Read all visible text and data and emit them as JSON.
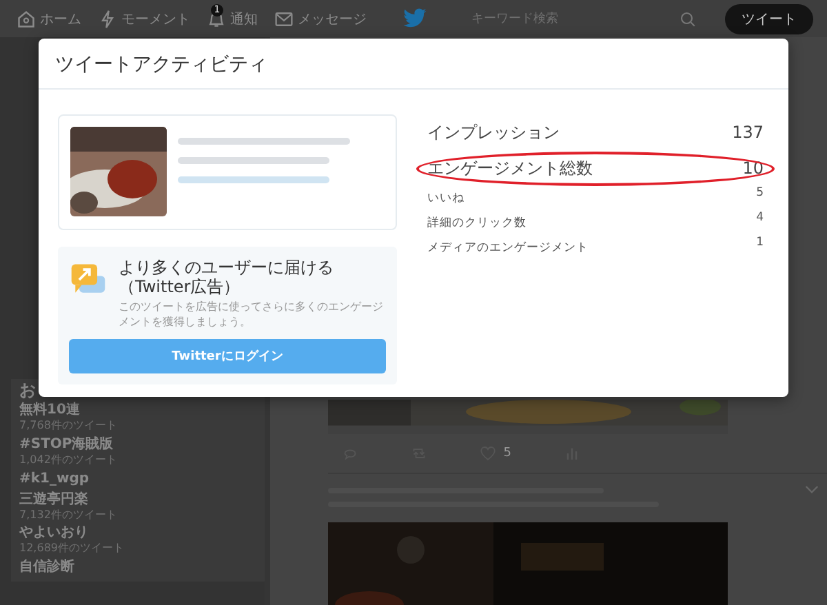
{
  "nav": {
    "items": [
      {
        "kind": "home",
        "label": "ホーム"
      },
      {
        "kind": "bolt",
        "label": "モーメント"
      },
      {
        "kind": "bell",
        "label": "通知",
        "badge": "1"
      },
      {
        "kind": "mail",
        "label": "メッセージ"
      }
    ],
    "search": {
      "placeholder": "キーワード検索"
    },
    "tweet_button": "ツイート"
  },
  "trends": {
    "heading": "お",
    "items": [
      {
        "name": "無料10連",
        "count": "7,768件のツイート"
      },
      {
        "name": "#STOP海賊版",
        "count": "1,042件のツイート"
      },
      {
        "name": "#k1_wgp"
      },
      {
        "name": "三遊亭円楽",
        "count": "7,132件のツイート"
      },
      {
        "name": "やよいおり",
        "count": "12,689件のツイート"
      },
      {
        "name": "自信診断"
      }
    ]
  },
  "feed": {
    "like_count": "5"
  },
  "modal": {
    "title": "ツイートアクティビティ",
    "promo": {
      "title": "より多くのユーザーに届ける（Twitter広告）",
      "text": "このツイートを広告に使ってさらに多くのエンゲージメントを獲得しましょう。",
      "button": "Twitterにログイン"
    },
    "metrics": [
      {
        "kind": "main",
        "label": "インプレッション",
        "value": "137",
        "circled": false
      },
      {
        "kind": "main",
        "label": "エンゲージメント総数",
        "value": "10",
        "circled": true
      },
      {
        "kind": "sub",
        "label": "いいね",
        "value": "5",
        "circled": false
      },
      {
        "kind": "sub",
        "label": "詳細のクリック数",
        "value": "4",
        "circled": false
      },
      {
        "kind": "sub",
        "label": "メディアのエンゲージメント",
        "value": "1",
        "circled": false
      }
    ]
  }
}
